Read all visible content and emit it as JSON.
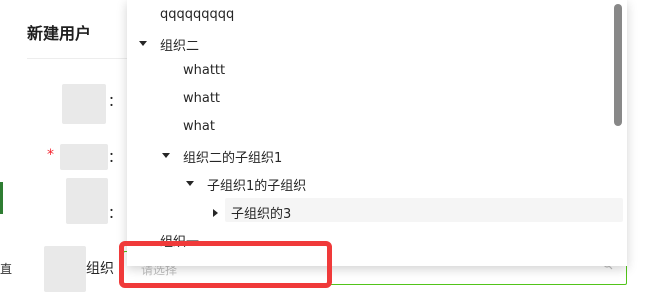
{
  "modal": {
    "title": "新建用户",
    "close_glyph": ")",
    "required_mark": "*",
    "label_tail_1": "：",
    "label_tail_2": "：",
    "label_tail_3": "：",
    "org_label": "组织",
    "left_glyph": "直"
  },
  "select": {
    "placeholder": "请选择"
  },
  "tree": {
    "items": [
      {
        "label": "qqqqqqqqq"
      },
      {
        "label": "组织二"
      },
      {
        "label": "whattt"
      },
      {
        "label": "whatt"
      },
      {
        "label": "what"
      },
      {
        "label": "组织二的子组织1"
      },
      {
        "label": "子组织1的子组织"
      },
      {
        "label": "子组织的3"
      },
      {
        "label": "组织一"
      }
    ]
  },
  "colors": {
    "annotation": "#f03a3a",
    "focus_border": "#52c41a",
    "required": "#f5222d"
  }
}
